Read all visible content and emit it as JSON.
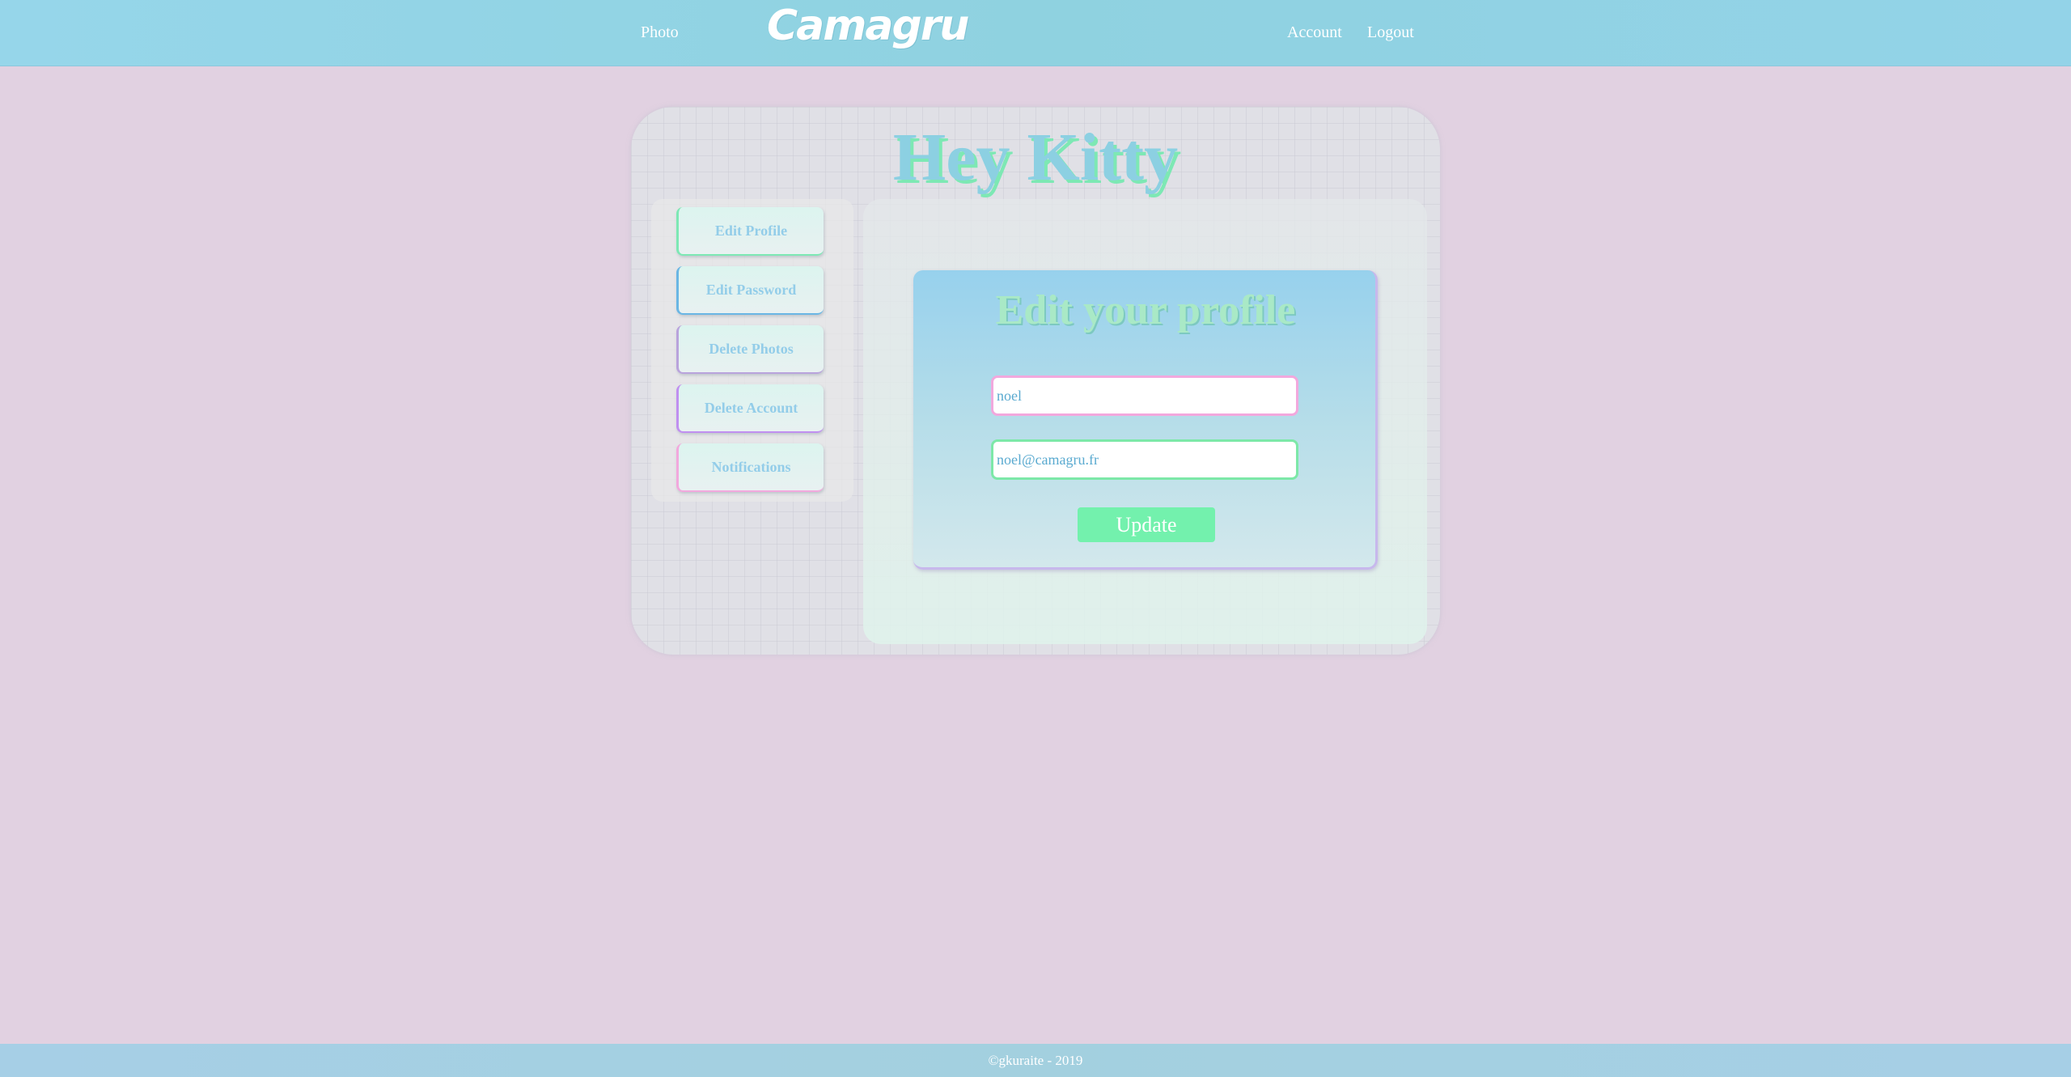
{
  "header": {
    "photo_link": "Photo",
    "logo_text": "Camagru",
    "account_link": "Account",
    "logout_link": "Logout"
  },
  "main": {
    "title": "Hey Kitty",
    "sidebar": {
      "items": [
        {
          "label": "Edit Profile",
          "accent": "#7de8b4"
        },
        {
          "label": "Edit Password",
          "accent": "#6ab6e4"
        },
        {
          "label": "Delete Photos",
          "accent": "#b9a3dc"
        },
        {
          "label": "Delete Account",
          "accent": "#c08ff0"
        },
        {
          "label": "Notifications",
          "accent": "#f2a8dd"
        }
      ]
    },
    "form": {
      "title": "Edit your profile",
      "username_value": "noel",
      "email_value": "noel@camagru.fr",
      "submit_label": "Update"
    }
  },
  "footer": {
    "text": "©gkuraite - 2019"
  },
  "colors": {
    "page_bg": "#e1d1e1",
    "header_bg": "#8fd2e0",
    "accent_green": "#73f1ad",
    "accent_blue": "#8cd0e2"
  }
}
